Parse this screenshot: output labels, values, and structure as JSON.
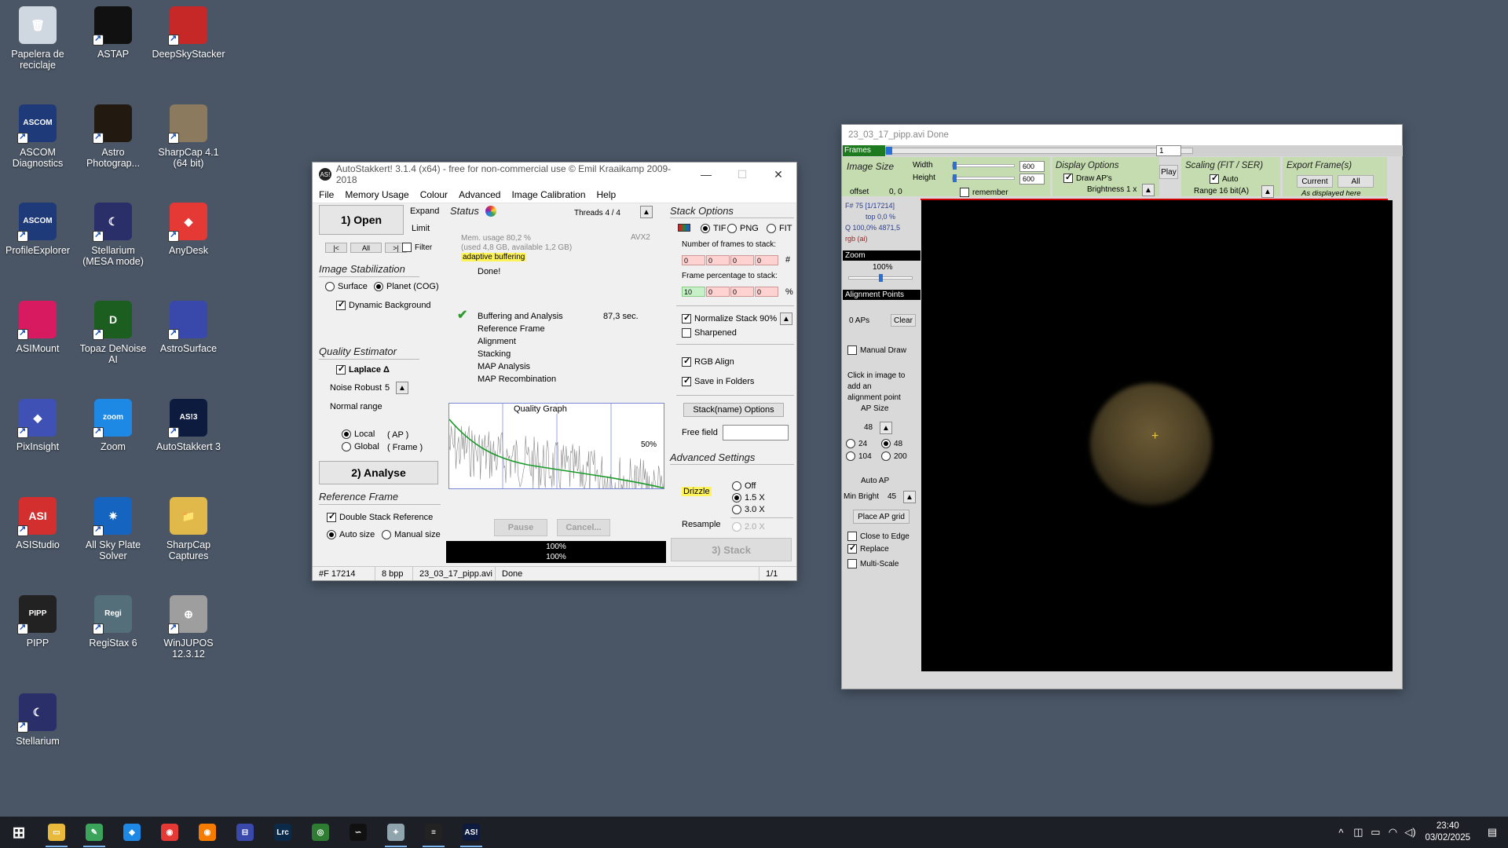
{
  "desktop": {
    "icons": [
      {
        "label": "Papelera de reciclaje",
        "color": "#cfd8e0"
      },
      {
        "label": "ASTAP",
        "color": "#111111"
      },
      {
        "label": "DeepSkyStacker",
        "color": "#c62828"
      },
      {
        "label": "ASCOM Diagnostics",
        "color": "#1e3a78"
      },
      {
        "label": "Astro Photograp...",
        "color": "#221a10"
      },
      {
        "label": "SharpCap 4.1 (64 bit)",
        "color": "#8b7a5e"
      },
      {
        "label": "ProfileExplorer",
        "color": "#1e3a78"
      },
      {
        "label": "Stellarium (MESA mode)",
        "color": "#2a2f6a"
      },
      {
        "label": "AnyDesk",
        "color": "#e53935"
      },
      {
        "label": "ASIMount",
        "color": "#d81b60"
      },
      {
        "label": "Topaz DeNoise AI",
        "color": "#1b5e20"
      },
      {
        "label": "AstroSurface",
        "color": "#3949ab"
      },
      {
        "label": "PixInsight",
        "color": "#3f51b5"
      },
      {
        "label": "Zoom",
        "color": "#1e88e5"
      },
      {
        "label": "AutoStakkert 3",
        "color": "#0d1b3e"
      },
      {
        "label": "ASIStudio",
        "color": "#d32f2f"
      },
      {
        "label": "All Sky Plate Solver",
        "color": "#1565c0"
      },
      {
        "label": "SharpCap Captures",
        "color": "#e0b94a"
      },
      {
        "label": "PIPP",
        "color": "#222222"
      },
      {
        "label": "RegiStax 6",
        "color": "#546e7a"
      },
      {
        "label": "WinJUPOS 12.3.12",
        "color": "#9e9e9e"
      },
      {
        "label": "Stellarium",
        "color": "#2a2f6a"
      }
    ],
    "icon_glyphs": [
      "🗑",
      "",
      "",
      "ASCOM",
      "",
      "",
      "ASCOM",
      "☾",
      "◆",
      "",
      "D",
      "",
      "◆",
      "zoom",
      "AS!3",
      "ASI",
      "✷",
      "📁",
      "PIPP",
      "Regi",
      "⊕",
      "☾"
    ]
  },
  "as_window": {
    "title": "AutoStakkert! 3.1.4 (x64) - free for non-commercial use © Emil Kraaikamp 2009-2018",
    "app_icon": "AS!",
    "menu": [
      "File",
      "Memory Usage",
      "Colour",
      "Advanced",
      "Image Calibration",
      "Help"
    ],
    "open_button": "1) Open",
    "expand": "Expand",
    "limit": "Limit",
    "nav": [
      "|<",
      "All",
      ">|"
    ],
    "filter": "Filter",
    "image_stabilization": "Image Stabilization",
    "surface": "Surface",
    "planet": "Planet (COG)",
    "dynamic_background": "Dynamic Background",
    "quality_estimator": "Quality Estimator",
    "laplace": "Laplace Δ",
    "noise_robust": "Noise Robust",
    "noise_value": "5",
    "normal_range": "Normal range",
    "local": "Local",
    "local_ap": "( AP )",
    "global": "Global",
    "global_frame": "( Frame )",
    "analyse_button": "2) Analyse",
    "reference_frame": "Reference Frame",
    "double_stack": "Double Stack Reference",
    "auto_size": "Auto size",
    "manual_size": "Manual size",
    "status_title": "Status",
    "threads": "Threads 4 / 4",
    "mem_usage": "Mem. usage 80,2 %",
    "mem_detail": "(used 4,8 GB, available 1,2 GB)",
    "avx": "AVX2",
    "adaptive": "adaptive buffering",
    "done": "Done!",
    "steps": [
      "Buffering and Analysis",
      "Reference Frame",
      "Alignment",
      "Stacking",
      "MAP Analysis",
      "MAP Recombination"
    ],
    "step_time": "87,3 sec.",
    "quality_graph": "Quality Graph",
    "graph_pct": "50%",
    "pause": "Pause",
    "cancel": "Cancel...",
    "progress1": "100%",
    "progress2": "100%",
    "stack_options": "Stack Options",
    "tif": "TIF",
    "png": "PNG",
    "fit": "FIT",
    "num_frames": "Number of frames to stack:",
    "num_frames_vals": [
      "0",
      "0",
      "0",
      "0"
    ],
    "hash": "#",
    "frame_pct": "Frame percentage to stack:",
    "frame_pct_vals": [
      "10",
      "0",
      "0",
      "0"
    ],
    "percent": "%",
    "normalize": "Normalize Stack 90%",
    "sharpened": "Sharpened",
    "rgb_align": "RGB Align",
    "save_folders": "Save in Folders",
    "stack_name_options": "Stack(name) Options",
    "free_field": "Free field",
    "advanced_settings": "Advanced Settings",
    "drizzle": "Drizzle",
    "off": "Off",
    "x15": "1.5 X",
    "x30": "3.0 X",
    "resample": "Resample",
    "x20": "2.0 X",
    "stack_button": "3) Stack",
    "statusbar": [
      "#F 17214",
      "8 bpp",
      "23_03_17_pipp.avi",
      "Done",
      "1/1"
    ]
  },
  "viewer": {
    "title": "23_03_17_pipp.avi  Done",
    "frames_label": "Frames",
    "frame_input": "1",
    "image_size": "Image Size",
    "width_label": "Width",
    "width_val": "600",
    "height_label": "Height",
    "height_val": "600",
    "offset_label": "offset",
    "offset_val": "0, 0",
    "remember": "remember",
    "display_options": "Display Options",
    "draw_aps": "Draw AP's",
    "brightness": "Brightness 1 x",
    "play": "Play",
    "scaling": "Scaling (FIT / SER)",
    "auto": "Auto",
    "range": "Range 16 bit(A)",
    "export": "Export Frame(s)",
    "current": "Current",
    "all": "All",
    "as_displayed": "As displayed here",
    "frame_info": "F# 75 [1/17214]",
    "top": "top 0,0 %",
    "q": "Q 100,0%  4871,5",
    "rgb": "rgb (ai)",
    "zoom": "Zoom",
    "zoom_val": "100%",
    "alignment_points": "Alignment Points",
    "aps": "0 APs",
    "clear": "Clear",
    "manual_draw": "Manual Draw",
    "click_hint": "Click in image to add an alignment point",
    "ap_size": "AP Size",
    "ap_val": "48",
    "ap_24": "24",
    "ap_48": "48",
    "ap_104": "104",
    "ap_200": "200",
    "auto_ap": "Auto AP",
    "min_bright": "Min Bright",
    "min_bright_val": "45",
    "place_grid": "Place AP grid",
    "close_edge": "Close to Edge",
    "replace": "Replace",
    "multi_scale": "Multi-Scale"
  },
  "taskbar": {
    "apps": [
      {
        "name": "windows-start-icon",
        "glyph": "⊞",
        "color": "transparent"
      },
      {
        "name": "file-explorer-icon",
        "glyph": "▭",
        "color": "#e8b93a"
      },
      {
        "name": "notepad-icon",
        "glyph": "✎",
        "color": "#3aa55a"
      },
      {
        "name": "vscode-icon",
        "glyph": "◆",
        "color": "#1e88e5"
      },
      {
        "name": "chrome-icon",
        "glyph": "◉",
        "color": "#e53935"
      },
      {
        "name": "firefox-icon",
        "glyph": "◉",
        "color": "#f57c00"
      },
      {
        "name": "network-icon",
        "glyph": "⊟",
        "color": "#3949ab"
      },
      {
        "name": "lightroom-icon",
        "glyph": "Lrc",
        "color": "#0b2a4a"
      },
      {
        "name": "green-app-icon",
        "glyph": "◎",
        "color": "#2e7d32"
      },
      {
        "name": "astro-app-icon",
        "glyph": "∽",
        "color": "#111111"
      },
      {
        "name": "paint-icon",
        "glyph": "✦",
        "color": "#90a4ae"
      },
      {
        "name": "pipp-icon",
        "glyph": "≡",
        "color": "#222222"
      },
      {
        "name": "autostakkert-icon",
        "glyph": "AS!",
        "color": "#0d1b3e"
      }
    ],
    "time": "23:40",
    "date": "03/02/2025"
  }
}
